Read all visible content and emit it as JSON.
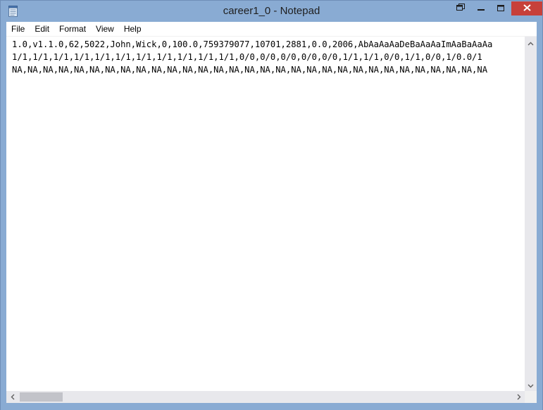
{
  "window": {
    "title": "career1_0 - Notepad"
  },
  "menu": {
    "items": [
      "File",
      "Edit",
      "Format",
      "View",
      "Help"
    ]
  },
  "editor": {
    "lines": [
      "1.0,v1.1.0,62,5022,John,Wick,0,100.0,759379077,10701,2881,0.0,2006,AbAaAaAaDeBaAaAaImAaBaAaAa",
      "1/1,1/1,1/1,1/1,1/1,1/1,1/1,1/1,1/1,1/1,1/1,0/0,0/0,0/0,0/0,0/0,1/1,1/1,0/0,1/1,0/0,1/0.0/1",
      "NA,NA,NA,NA,NA,NA,NA,NA,NA,NA,NA,NA,NA,NA,NA,NA,NA,NA,NA,NA,NA,NA,NA,NA,NA,NA,NA,NA,NA,NA,NA"
    ]
  },
  "icons": {
    "app": "notepad-icon",
    "restore_down": "restore-down-icon",
    "minimize": "minimize-icon",
    "maximize": "maximize-icon",
    "close": "close-icon",
    "scroll_up": "arrow-up-icon",
    "scroll_down": "arrow-down-icon",
    "scroll_left": "arrow-left-icon",
    "scroll_right": "arrow-right-icon"
  },
  "colors": {
    "frame": "#89abd3",
    "close_button": "#c7403a",
    "editor_background": "#ffffff",
    "scrollbar_track": "#e8e8ec",
    "scrollbar_thumb": "#c2c3c9"
  }
}
